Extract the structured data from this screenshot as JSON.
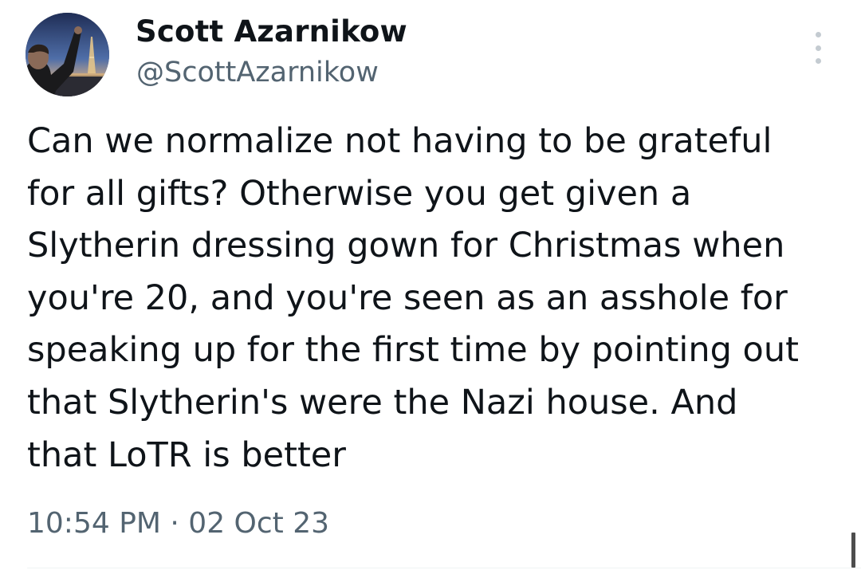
{
  "author": {
    "display_name": "Scott Azarnikow",
    "handle": "@ScottAzarnikow",
    "avatar_icon": "profile-photo-icon"
  },
  "menu": {
    "icon": "more-vertical-icon"
  },
  "tweet": {
    "lines": [
      "Can we normalize not having to be grateful",
      "for all gifts? Otherwise you get given a",
      "Slytherin dressing gown for Christmas when",
      "you're 20, and you're seen as an asshole for",
      "speaking up for the first time by pointing out",
      "that Slytherin's were the Nazi house. And",
      "that LoTR is better"
    ],
    "timestamp": "10:54 PM · 02 Oct 23"
  },
  "colors": {
    "text": "#0f1419",
    "secondary": "#536471",
    "menu_dots": "#c4cbd1"
  }
}
